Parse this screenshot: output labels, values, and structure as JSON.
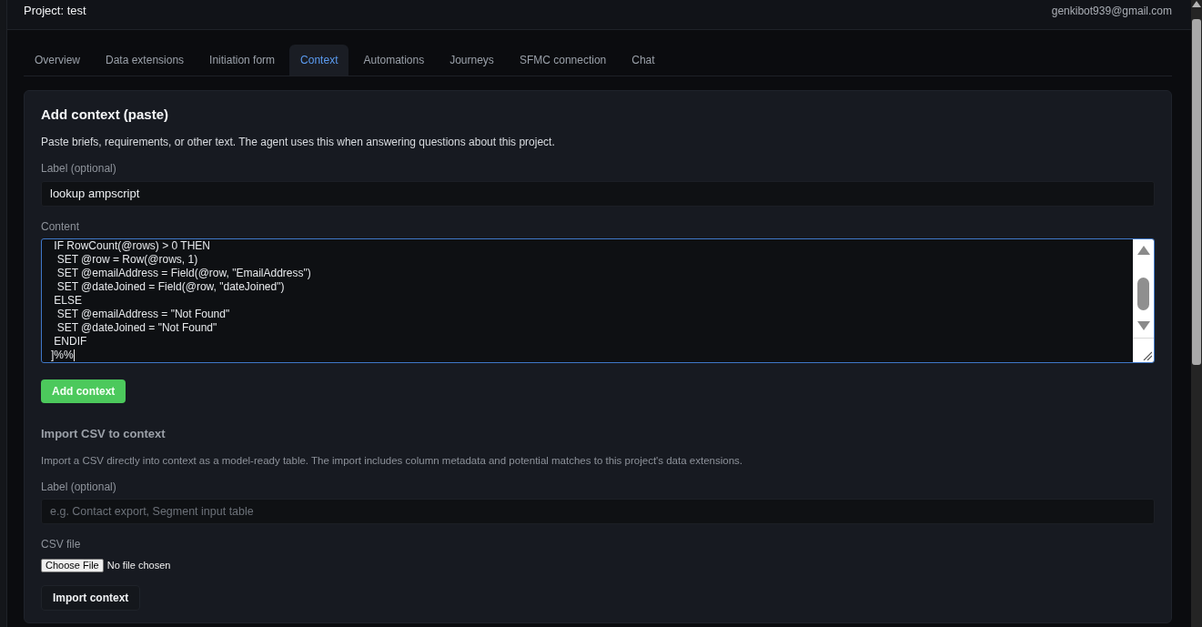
{
  "header": {
    "project_title": "Project: test",
    "user_email": "genkibot939@gmail.com"
  },
  "tabs": [
    {
      "label": "Overview",
      "selected": false
    },
    {
      "label": "Data extensions",
      "selected": false
    },
    {
      "label": "Initiation form",
      "selected": false
    },
    {
      "label": "Context",
      "selected": true
    },
    {
      "label": "Automations",
      "selected": false
    },
    {
      "label": "Journeys",
      "selected": false
    },
    {
      "label": "SFMC connection",
      "selected": false
    },
    {
      "label": "Chat",
      "selected": false
    }
  ],
  "paste_section": {
    "title": "Add context (paste)",
    "description": "Paste briefs, requirements, or other text. The agent uses this when answering questions about this project.",
    "label_field": {
      "label": "Label (optional)",
      "value": "lookup ampscript"
    },
    "content_field": {
      "label": "Content",
      "focused": true,
      "lines": [
        " IF RowCount(@rows) > 0 THEN",
        "  SET @row = Row(@rows, 1)",
        "  SET @emailAddress = Field(@row, \"EmailAddress\")",
        "  SET @dateJoined = Field(@row, \"dateJoined\")",
        " ELSE",
        "  SET @emailAddress = \"Not Found\"",
        "  SET @dateJoined = \"Not Found\"",
        " ENDIF",
        "]%%"
      ]
    },
    "button": "Add context"
  },
  "import_section": {
    "title": "Import CSV to context",
    "description": "Import a CSV directly into context as a model-ready table. The import includes column metadata and potential matches to this project's data extensions.",
    "label_field": {
      "label": "Label (optional)",
      "placeholder": "e.g. Contact export, Segment input table"
    },
    "file_field": {
      "label": "CSV file",
      "button": "Choose File",
      "status": "No file chosen"
    },
    "button": "Import context"
  }
}
